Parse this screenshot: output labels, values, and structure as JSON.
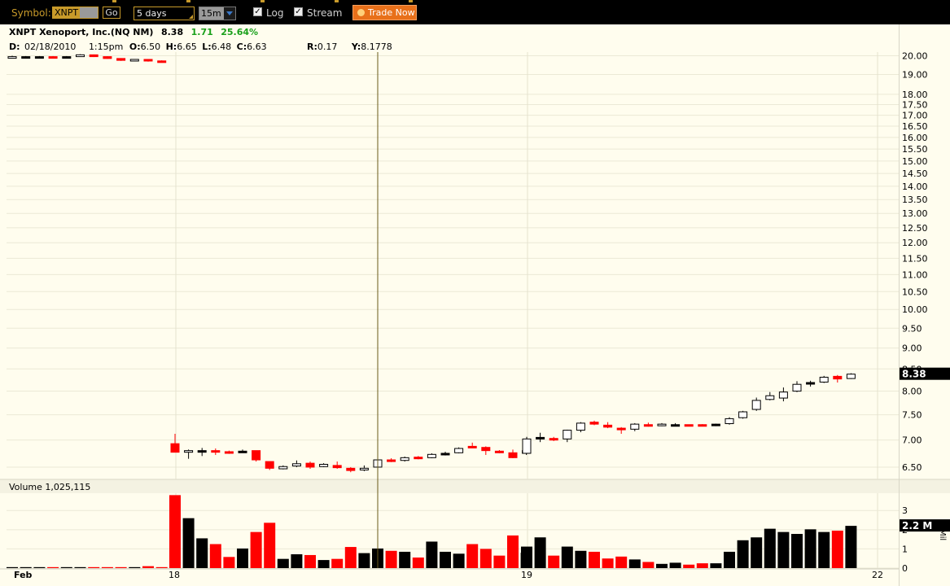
{
  "toolbar": {
    "symbol_label": "Symbol:",
    "symbol_value": "XNPT",
    "go_label": "Go",
    "range_value": "5 days",
    "interval_value": "15m",
    "log_label": "Log",
    "log_checked": true,
    "stream_label": "Stream",
    "stream_checked": true,
    "trade_label": "Trade Now"
  },
  "quote": {
    "title": "XNPT Xenoport, Inc.(NQ NM)",
    "last": "8.38",
    "change": "1.71",
    "change_pct": "25.64%",
    "date_label": "D:",
    "date": "02/18/2010",
    "time": "1:15pm",
    "o_label": "O:",
    "o": "6.50",
    "h_label": "H:",
    "h": "6.65",
    "l_label": "L:",
    "l": "6.48",
    "c_label": "C:",
    "c": "6.63",
    "r_label": "R:",
    "r": "0.17",
    "y_label": "Y:",
    "y": "8.1778"
  },
  "volume": {
    "label": "Volume",
    "value": "1,025,115",
    "current_tag": "2.2 M",
    "unit_label": "Mil",
    "axis_ticks": [
      "3",
      "2",
      "1",
      "0"
    ]
  },
  "price_axis": {
    "ticks": [
      "20.00",
      "19.00",
      "18.00",
      "17.50",
      "17.00",
      "16.50",
      "16.00",
      "15.50",
      "15.00",
      "14.50",
      "14.00",
      "13.50",
      "13.00",
      "12.50",
      "12.00",
      "11.50",
      "11.00",
      "10.50",
      "10.00",
      "9.50",
      "9.00",
      "8.50",
      "8.00",
      "7.50",
      "7.00",
      "6.50"
    ],
    "current_tag": "8.38"
  },
  "x_axis": {
    "labels": [
      "Feb",
      "18",
      "19",
      "22"
    ]
  },
  "colors": {
    "up": "#ffffff",
    "down": "#ff0000",
    "black_candle": "#000000",
    "background": "#fffdee",
    "accent": "#c89a2a",
    "trade_button": "#e8701a",
    "change_positive": "#1aa01a"
  },
  "chart_data": {
    "type": "candlestick",
    "scale": "log",
    "ylim": [
      6.3,
      20.2
    ],
    "volume_ylim_millions": [
      0,
      3.9
    ],
    "candles": [
      {
        "o": 19.95,
        "c": 19.95,
        "h": 20.0,
        "l": 19.9,
        "color": "white",
        "v": 0.05
      },
      {
        "o": 19.95,
        "c": 19.95,
        "h": 19.98,
        "l": 19.92,
        "color": "black",
        "v": 0.05
      },
      {
        "o": 19.95,
        "c": 19.95,
        "h": 19.98,
        "l": 19.92,
        "color": "black",
        "v": 0.05
      },
      {
        "o": 19.95,
        "c": 19.9,
        "h": 19.98,
        "l": 19.88,
        "color": "red",
        "v": 0.05
      },
      {
        "o": 19.95,
        "c": 19.95,
        "h": 19.98,
        "l": 19.92,
        "color": "black",
        "v": 0.05
      },
      {
        "o": 19.95,
        "c": 20.05,
        "h": 20.08,
        "l": 19.93,
        "color": "white",
        "v": 0.05
      },
      {
        "o": 20.05,
        "c": 19.95,
        "h": 20.07,
        "l": 19.93,
        "color": "red",
        "v": 0.05
      },
      {
        "o": 19.95,
        "c": 19.85,
        "h": 19.97,
        "l": 19.83,
        "color": "red",
        "v": 0.05
      },
      {
        "o": 19.85,
        "c": 19.75,
        "h": 19.87,
        "l": 19.72,
        "color": "red",
        "v": 0.05
      },
      {
        "o": 19.75,
        "c": 19.8,
        "h": 19.82,
        "l": 19.72,
        "color": "white",
        "v": 0.05
      },
      {
        "o": 19.8,
        "c": 19.72,
        "h": 19.82,
        "l": 19.68,
        "color": "red",
        "v": 0.1
      },
      {
        "o": 19.72,
        "c": 19.7,
        "h": 19.75,
        "l": 19.65,
        "color": "red",
        "v": 0.05
      },
      {
        "o": 6.93,
        "c": 6.77,
        "h": 7.12,
        "l": 6.77,
        "color": "red",
        "v": 3.8
      },
      {
        "o": 6.78,
        "c": 6.8,
        "h": 6.82,
        "l": 6.65,
        "color": "white",
        "v": 2.6
      },
      {
        "o": 6.8,
        "c": 6.78,
        "h": 6.85,
        "l": 6.7,
        "color": "black",
        "v": 1.55
      },
      {
        "o": 6.8,
        "c": 6.8,
        "h": 6.84,
        "l": 6.72,
        "color": "red",
        "v": 1.25
      },
      {
        "o": 6.78,
        "c": 6.76,
        "h": 6.8,
        "l": 6.74,
        "color": "red",
        "v": 0.58
      },
      {
        "o": 6.77,
        "c": 6.79,
        "h": 6.82,
        "l": 6.76,
        "color": "black",
        "v": 1.02
      },
      {
        "o": 6.8,
        "c": 6.63,
        "h": 6.8,
        "l": 6.6,
        "color": "red",
        "v": 1.88
      },
      {
        "o": 6.6,
        "c": 6.48,
        "h": 6.6,
        "l": 6.45,
        "color": "red",
        "v": 2.36
      },
      {
        "o": 6.47,
        "c": 6.51,
        "h": 6.53,
        "l": 6.46,
        "color": "white",
        "v": 0.48
      },
      {
        "o": 6.52,
        "c": 6.56,
        "h": 6.62,
        "l": 6.5,
        "color": "white",
        "v": 0.72
      },
      {
        "o": 6.57,
        "c": 6.5,
        "h": 6.6,
        "l": 6.47,
        "color": "red",
        "v": 0.68
      },
      {
        "o": 6.51,
        "c": 6.55,
        "h": 6.57,
        "l": 6.5,
        "color": "white",
        "v": 0.42
      },
      {
        "o": 6.53,
        "c": 6.49,
        "h": 6.6,
        "l": 6.47,
        "color": "red",
        "v": 0.48
      },
      {
        "o": 6.48,
        "c": 6.44,
        "h": 6.5,
        "l": 6.41,
        "color": "red",
        "v": 1.1
      },
      {
        "o": 6.45,
        "c": 6.48,
        "h": 6.53,
        "l": 6.43,
        "color": "white",
        "v": 0.78
      },
      {
        "o": 6.5,
        "c": 6.63,
        "h": 6.65,
        "l": 6.48,
        "color": "white",
        "v": 1.02
      },
      {
        "o": 6.63,
        "c": 6.6,
        "h": 6.66,
        "l": 6.59,
        "color": "red",
        "v": 0.9
      },
      {
        "o": 6.62,
        "c": 6.67,
        "h": 6.69,
        "l": 6.6,
        "color": "white",
        "v": 0.85
      },
      {
        "o": 6.68,
        "c": 6.65,
        "h": 6.7,
        "l": 6.64,
        "color": "red",
        "v": 0.55
      },
      {
        "o": 6.67,
        "c": 6.73,
        "h": 6.75,
        "l": 6.66,
        "color": "white",
        "v": 1.38
      },
      {
        "o": 6.72,
        "c": 6.75,
        "h": 6.78,
        "l": 6.71,
        "color": "black",
        "v": 0.85
      },
      {
        "o": 6.76,
        "c": 6.84,
        "h": 6.86,
        "l": 6.75,
        "color": "white",
        "v": 0.75
      },
      {
        "o": 6.88,
        "c": 6.88,
        "h": 6.95,
        "l": 6.85,
        "color": "red",
        "v": 1.25
      },
      {
        "o": 6.86,
        "c": 6.8,
        "h": 6.88,
        "l": 6.72,
        "color": "red",
        "v": 1.0
      },
      {
        "o": 6.79,
        "c": 6.77,
        "h": 6.81,
        "l": 6.75,
        "color": "red",
        "v": 0.65
      },
      {
        "o": 6.76,
        "c": 6.67,
        "h": 6.82,
        "l": 6.66,
        "color": "red",
        "v": 1.7
      },
      {
        "o": 6.75,
        "c": 6.8,
        "h": 6.82,
        "l": 6.72,
        "color": "black",
        "v": 0.8
      },
      {
        "o": 6.75,
        "c": 7.02,
        "h": 7.06,
        "l": 6.74,
        "color": "white",
        "v": 1.12
      },
      {
        "o": 7.03,
        "c": 7.05,
        "h": 7.14,
        "l": 6.96,
        "color": "black",
        "v": 1.6
      },
      {
        "o": 7.03,
        "c": 7.0,
        "h": 7.06,
        "l": 6.98,
        "color": "red",
        "v": 0.65
      },
      {
        "o": 7.02,
        "c": 7.19,
        "h": 7.2,
        "l": 6.96,
        "color": "white",
        "v": 1.12
      },
      {
        "o": 7.19,
        "c": 7.33,
        "h": 7.35,
        "l": 7.15,
        "color": "white",
        "v": 0.9
      },
      {
        "o": 7.35,
        "c": 7.31,
        "h": 7.38,
        "l": 7.29,
        "color": "red",
        "v": 0.85
      },
      {
        "o": 7.29,
        "c": 7.25,
        "h": 7.35,
        "l": 7.23,
        "color": "red",
        "v": 0.5
      },
      {
        "o": 7.23,
        "c": 7.2,
        "h": 7.25,
        "l": 7.12,
        "color": "red",
        "v": 0.6
      },
      {
        "o": 7.21,
        "c": 7.31,
        "h": 7.33,
        "l": 7.17,
        "color": "white",
        "v": 0.45
      },
      {
        "o": 7.3,
        "c": 7.28,
        "h": 7.34,
        "l": 7.26,
        "color": "red",
        "v": 0.32
      },
      {
        "o": 7.28,
        "c": 7.31,
        "h": 7.33,
        "l": 7.27,
        "color": "white",
        "v": 0.22
      },
      {
        "o": 7.3,
        "c": 7.3,
        "h": 7.33,
        "l": 7.27,
        "color": "black",
        "v": 0.28
      },
      {
        "o": 7.3,
        "c": 7.29,
        "h": 7.3,
        "l": 7.28,
        "color": "red",
        "v": 0.18
      },
      {
        "o": 7.3,
        "c": 7.3,
        "h": 7.31,
        "l": 7.28,
        "color": "red",
        "v": 0.25
      },
      {
        "o": 7.28,
        "c": 7.31,
        "h": 7.32,
        "l": 7.27,
        "color": "black",
        "v": 0.25
      },
      {
        "o": 7.32,
        "c": 7.42,
        "h": 7.45,
        "l": 7.3,
        "color": "white",
        "v": 0.85
      },
      {
        "o": 7.44,
        "c": 7.56,
        "h": 7.58,
        "l": 7.42,
        "color": "white",
        "v": 1.45
      },
      {
        "o": 7.61,
        "c": 7.8,
        "h": 7.86,
        "l": 7.58,
        "color": "white",
        "v": 1.6
      },
      {
        "o": 7.82,
        "c": 7.9,
        "h": 7.98,
        "l": 7.8,
        "color": "white",
        "v": 2.05
      },
      {
        "o": 7.85,
        "c": 7.98,
        "h": 8.08,
        "l": 7.78,
        "color": "white",
        "v": 1.88
      },
      {
        "o": 8.0,
        "c": 8.15,
        "h": 8.22,
        "l": 7.98,
        "color": "white",
        "v": 1.78
      },
      {
        "o": 8.17,
        "c": 8.19,
        "h": 8.23,
        "l": 8.1,
        "color": "black",
        "v": 2.02
      },
      {
        "o": 8.2,
        "c": 8.31,
        "h": 8.34,
        "l": 8.18,
        "color": "white",
        "v": 1.88
      },
      {
        "o": 8.33,
        "c": 8.27,
        "h": 8.36,
        "l": 8.19,
        "color": "red",
        "v": 1.95
      },
      {
        "o": 8.28,
        "c": 8.38,
        "h": 8.4,
        "l": 8.27,
        "color": "white",
        "v": 2.2
      }
    ]
  }
}
